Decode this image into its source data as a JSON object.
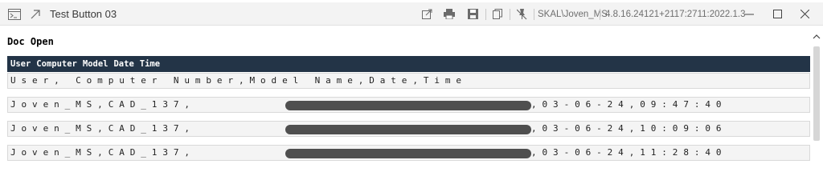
{
  "window": {
    "title": "Test Button 03",
    "user": "SKAL\\Joven_MS",
    "version": "4.8.16.24121+2117:2711:2022.1.3"
  },
  "document": {
    "title": "Doc Open",
    "table": {
      "headers": [
        "User",
        "Computer",
        "Model",
        "Date",
        "Time"
      ],
      "rows": [
        {
          "prefix": "User, Computer Number,Model Name,Date,Time",
          "suffix": "",
          "redacted": false
        },
        {
          "prefix": "Joven_MS,CAD_137,",
          "suffix": ",03-06-24,09:47:40",
          "redacted": true
        },
        {
          "prefix": "Joven_MS,CAD_137,",
          "suffix": ",03-06-24,10:09:06",
          "redacted": true
        },
        {
          "prefix": "Joven_MS,CAD_137,",
          "suffix": ",03-06-24,11:28:40",
          "redacted": true
        }
      ]
    }
  },
  "icons": {
    "app": "terminal-icon",
    "pin": "arrow-up-right-icon",
    "popout": "open-external-icon",
    "print": "print-icon",
    "save": "save-icon",
    "copy": "copy-icon",
    "mute": "pin-off-icon",
    "minimize": "minimize-icon",
    "maximize": "maximize-icon",
    "close": "close-icon",
    "scroll_up": "chevron-up-icon"
  },
  "colors": {
    "header_bg": "#233447",
    "redaction": "#4f4f4f"
  }
}
